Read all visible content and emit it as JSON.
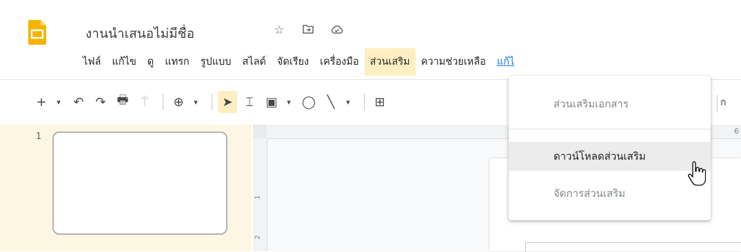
{
  "app": {
    "title": "งานนำเสนอไม่มีชื่อ",
    "title_icons": [
      "star-icon",
      "move-to-folder-icon",
      "cloud-saved-icon"
    ],
    "logo": "google-slides-logo",
    "brand_color": "#f4b400"
  },
  "menubar": {
    "items": [
      {
        "label": "ไฟล์"
      },
      {
        "label": "แก้ไข"
      },
      {
        "label": "ดู"
      },
      {
        "label": "แทรก"
      },
      {
        "label": "รูปแบบ"
      },
      {
        "label": "สไลด์"
      },
      {
        "label": "จัดเรียง"
      },
      {
        "label": "เครื่องมือ"
      },
      {
        "label": "ส่วนเสริม",
        "active": true
      },
      {
        "label": "ความช่วยเหลือ"
      },
      {
        "label": "แก้ไ"
      }
    ]
  },
  "toolbar": {
    "new_slide": "+",
    "dropdown_arrow": "▾",
    "undo": "↶",
    "redo": "↷",
    "print": "🖶",
    "paint_format": "⍑",
    "zoom": "⊕",
    "select": "➤",
    "textbox": "⌶",
    "image": "▣",
    "shape": "◯",
    "line": "╲",
    "comment": "⊞",
    "trailing_text": "ก"
  },
  "filmstrip": {
    "slides": [
      {
        "number": "1"
      }
    ]
  },
  "ruler": {
    "top_mark": "6",
    "left_marks": [
      "1",
      "2"
    ]
  },
  "addons_menu": {
    "items": [
      {
        "label": "ส่วนเสริมเอกสาร",
        "state": "disabled"
      },
      {
        "label": "ดาวน์โหลดส่วนเสริม",
        "state": "hover"
      },
      {
        "label": "จัดการส่วนเสริม",
        "state": "disabled"
      }
    ]
  }
}
